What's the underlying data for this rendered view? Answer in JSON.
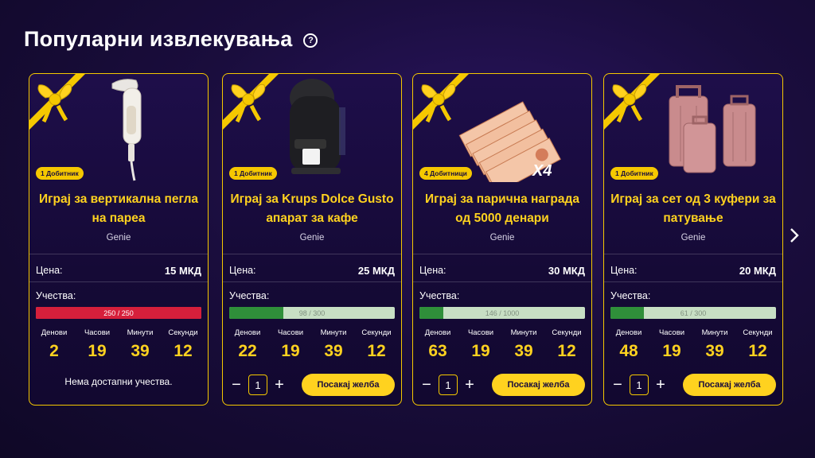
{
  "header": {
    "title": "Популарни извлекувања",
    "help_icon": "question-circle-icon"
  },
  "nav": {
    "prev_icon": "chevron-left-icon",
    "next_icon": "chevron-right-icon"
  },
  "colors": {
    "accent": "#ffd21f",
    "border": "#f5c800",
    "progress_green": "#2f8f3a",
    "progress_red": "#d61f3b"
  },
  "labels": {
    "price": "Цена:",
    "entries": "Учества:",
    "days": "Денови",
    "hours": "Часови",
    "minutes": "Минути",
    "seconds": "Секунди",
    "wish_button": "Посакај желба",
    "no_entries": "Нема достапни учества.",
    "minus": "−",
    "plus": "+"
  },
  "cards": [
    {
      "winners": "1 Добитник",
      "title": "Играј за вертикална пегла на пареа",
      "provider": "Genie",
      "price": "15 МКД",
      "entries_text": "250 / 250",
      "progress_fraction": 1.0,
      "days": "2",
      "hours": "19",
      "minutes": "39",
      "seconds": "12",
      "sold_out": true,
      "quantity": "1"
    },
    {
      "winners": "1 Добитник",
      "title": "Играј за Krups Dolce Gusto апарат за кафе",
      "provider": "Genie",
      "price": "25 МКД",
      "entries_text": "98 / 300",
      "progress_fraction": 0.327,
      "days": "22",
      "hours": "19",
      "minutes": "39",
      "seconds": "12",
      "sold_out": false,
      "quantity": "1"
    },
    {
      "winners": "4 Добитници",
      "title": "Играј за парична награда од 5000 денари",
      "provider": "Genie",
      "price": "30 МКД",
      "entries_text": "146 / 1000",
      "progress_fraction": 0.146,
      "badge_extra": "X4",
      "days": "63",
      "hours": "19",
      "minutes": "39",
      "seconds": "12",
      "sold_out": false,
      "quantity": "1"
    },
    {
      "winners": "1 Добитник",
      "title": "Играј за сет од 3 куфери за патување",
      "provider": "Genie",
      "price": "20 МКД",
      "entries_text": "61 / 300",
      "progress_fraction": 0.203,
      "days": "48",
      "hours": "19",
      "minutes": "39",
      "seconds": "12",
      "sold_out": false,
      "quantity": "1"
    }
  ]
}
